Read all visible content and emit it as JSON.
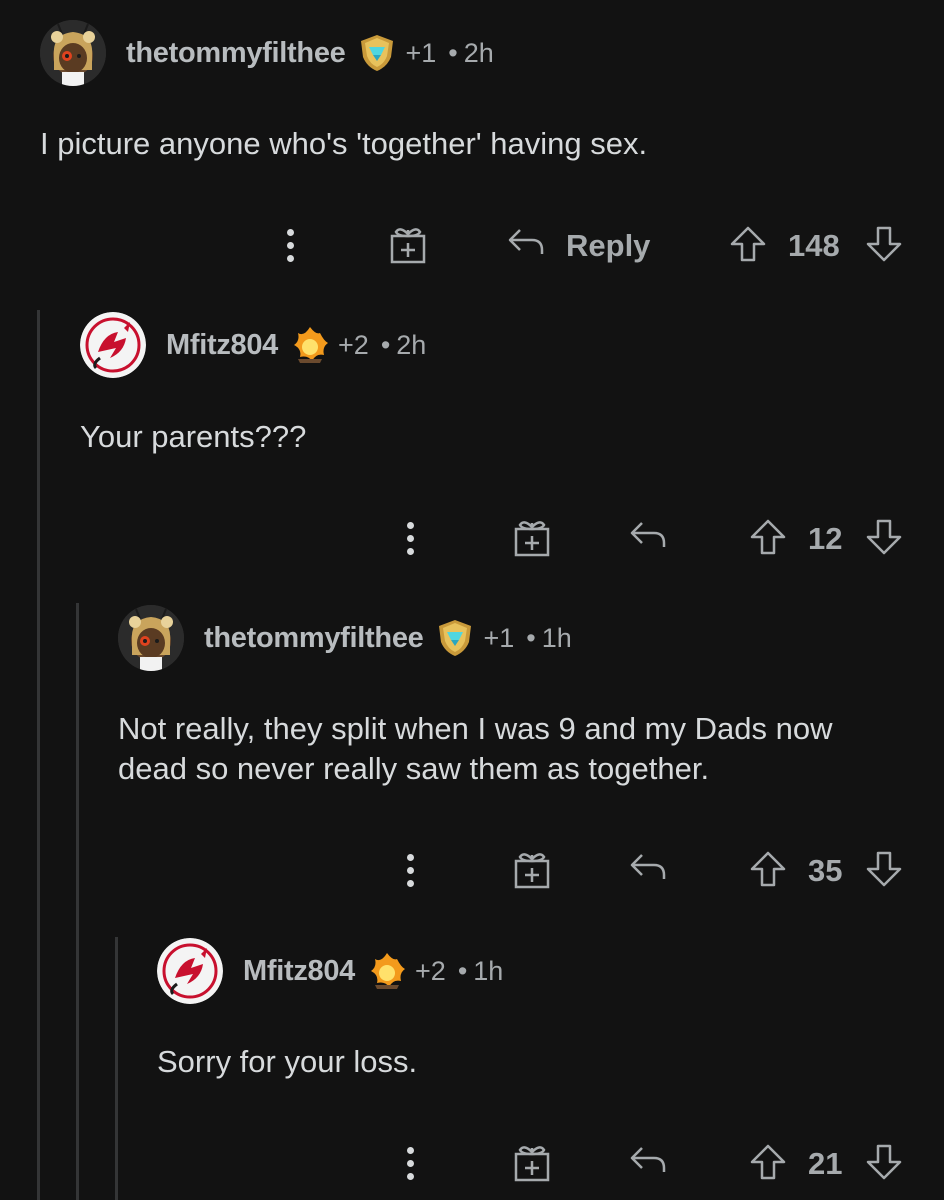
{
  "comments": [
    {
      "username": "thetommyfilthee",
      "karma": "+1",
      "separator": "•",
      "time": "2h",
      "body": "I picture anyone who's 'together' having sex.",
      "reply_label": "Reply",
      "votes": "148",
      "avatar_icon": "bee-avatar-icon",
      "flair_icon": "gem-shield-award-icon"
    },
    {
      "username": "Mfitz804",
      "karma": "+2",
      "separator": "•",
      "time": "2h",
      "body": "Your parents???",
      "votes": "12",
      "avatar_icon": "devils-logo-avatar-icon",
      "flair_icon": "flame-award-icon"
    },
    {
      "username": "thetommyfilthee",
      "karma": "+1",
      "separator": "•",
      "time": "1h",
      "body_line1": "Not really, they split when I was 9 and my Dads now",
      "body_line2": "dead so never really saw them as together.",
      "votes": "35",
      "avatar_icon": "bee-avatar-icon",
      "flair_icon": "gem-shield-award-icon"
    },
    {
      "username": "Mfitz804",
      "karma": "+2",
      "separator": "•",
      "time": "1h",
      "body": "Sorry for your loss.",
      "votes": "21",
      "avatar_icon": "devils-logo-avatar-icon",
      "flair_icon": "flame-award-icon"
    }
  ],
  "colors": {
    "background": "#121212",
    "text": "#d7dadc",
    "muted": "#a6aaad",
    "thread_line": "#343536"
  }
}
